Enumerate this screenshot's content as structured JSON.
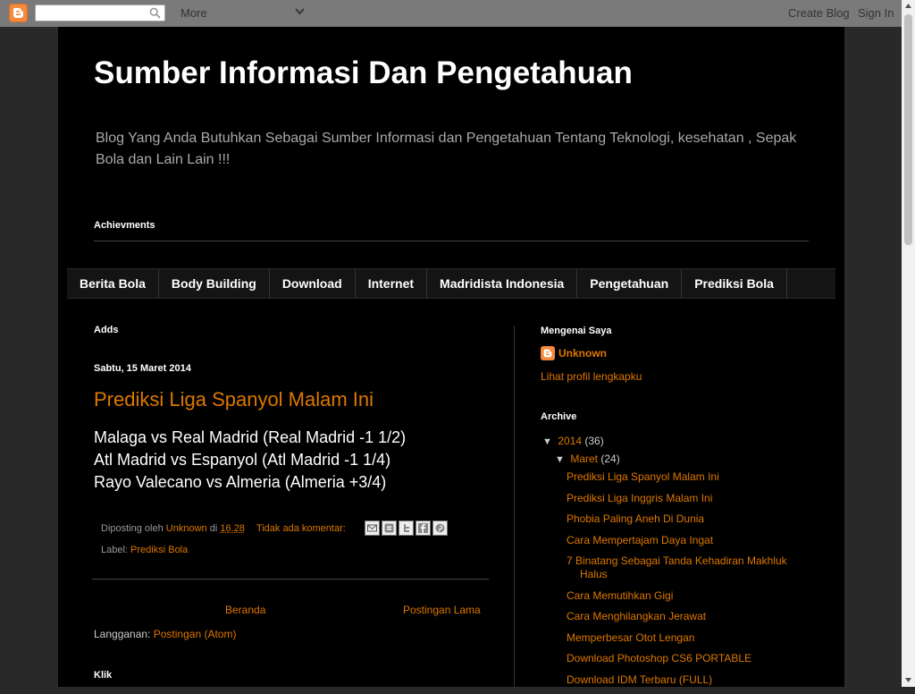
{
  "navbar": {
    "search_placeholder": "",
    "more_label": "More",
    "create_blog": "Create Blog",
    "sign_in": "Sign In"
  },
  "header": {
    "title": "Sumber Informasi Dan Pengetahuan",
    "description": "Blog Yang Anda Butuhkan Sebagai Sumber Informasi dan Pengetahuan Tentang Teknologi, kesehatan , Sepak Bola dan Lain Lain !!!",
    "achievements_label": "Achievments"
  },
  "tabs": [
    "Berita Bola",
    "Body Building",
    "Download",
    "Internet",
    "Madridista Indonesia",
    "Pengetahuan",
    "Prediksi Bola"
  ],
  "main": {
    "adds_label": "Adds",
    "date_header": "Sabtu, 15 Maret 2014",
    "post": {
      "title": "Prediksi Liga Spanyol Malam Ini",
      "lines": [
        "Malaga vs Real Madrid (Real Madrid -1 1/2)",
        "Atl Madrid vs Espanyol (Atl Madrid -1 1/4)",
        "Rayo Valecano vs Almeria (Almeria +3/4)"
      ],
      "posted_by_prefix": "Diposting oleh",
      "author": "Unknown",
      "at_word": "di",
      "time": "16.28",
      "comments": "Tidak ada komentar:",
      "label_prefix": "Label:",
      "label": "Prediksi Bola"
    },
    "pager": {
      "home": "Beranda",
      "older": "Postingan Lama"
    },
    "subscribe_prefix": "Langganan:",
    "subscribe_link": "Postingan (Atom)",
    "klik_label": "Klik"
  },
  "sidebar": {
    "about_title": "Mengenai Saya",
    "profile_name": "Unknown",
    "profile_link": "Lihat profil lengkapku",
    "archive_title": "Archive",
    "year": {
      "toggle": "▼",
      "label": "2014",
      "count": "(36)"
    },
    "month": {
      "toggle": "▼",
      "label": "Maret",
      "count": "(24)"
    },
    "posts": [
      "Prediksi Liga Spanyol Malam Ini",
      "Prediksi Liga Inggris Malam Ini",
      "Phobia Paling Aneh Di Dunia",
      "Cara Mempertajam Daya Ingat",
      "7 Binatang Sebagai Tanda Kehadiran Makhluk Halus",
      "Cara Memutihkan Gigi",
      "Cara Menghilangkan Jerawat",
      "Memperbesar Otot Lengan",
      "Download Photoshop CS6 PORTABLE",
      "Download IDM Terbaru (FULL)"
    ]
  },
  "colors": {
    "link": "#dd7700",
    "background": "#292929",
    "content": "#000000",
    "blogger_orange": "#f58a3c"
  }
}
